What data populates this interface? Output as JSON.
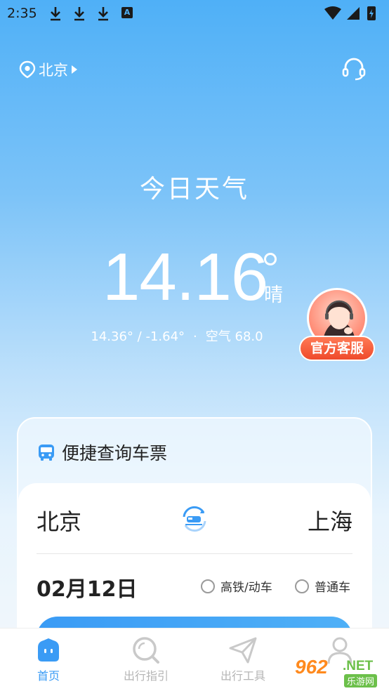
{
  "status_bar": {
    "time": "2:35",
    "a_badge": "A"
  },
  "header": {
    "location": "北京"
  },
  "weather": {
    "title": "今日天气",
    "temperature": "14.16",
    "condition": "晴",
    "range": "14.36° / -1.64°",
    "separator": "·",
    "air": "空气 68.0"
  },
  "service": {
    "badge_label": "官方客服"
  },
  "ticket_card": {
    "title": "便捷查询车票",
    "from_city": "北京",
    "to_city": "上海",
    "date": "02月12日",
    "option_1": "高铁/动车",
    "option_2": "普通车"
  },
  "bottom_nav": {
    "items": [
      {
        "label": "首页",
        "active": true
      },
      {
        "label": "出行指引",
        "active": false
      },
      {
        "label": "出行工具",
        "active": false
      },
      {
        "label": "",
        "active": false
      }
    ]
  },
  "watermark": {
    "number": "962",
    "suffix": ".NET",
    "sub": "乐游网"
  },
  "colors": {
    "primary": "#3a9bf5",
    "sky_top": "#4fb0f7",
    "badge_orange": "#ef4a2b",
    "inactive": "#b5b5b5"
  }
}
